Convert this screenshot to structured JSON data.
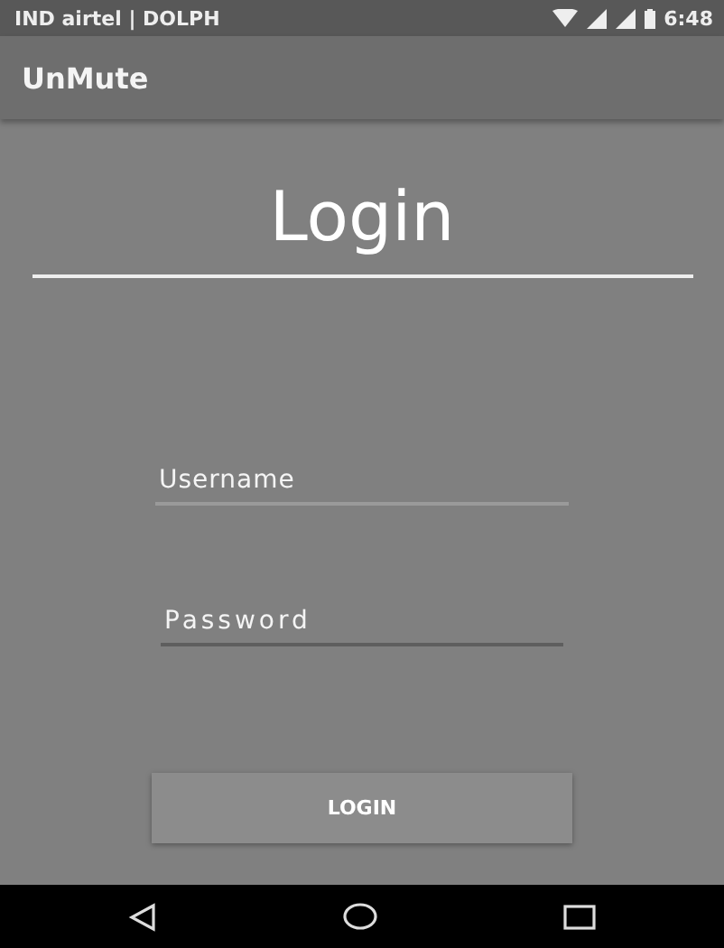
{
  "status_bar": {
    "carrier": "IND airtel | DOLPH",
    "time": "6:48"
  },
  "app_bar": {
    "title": "UnMute"
  },
  "heading": "Login",
  "fields": [
    {
      "placeholder": "Username"
    },
    {
      "placeholder": "Password"
    }
  ],
  "button": "LOGIN"
}
